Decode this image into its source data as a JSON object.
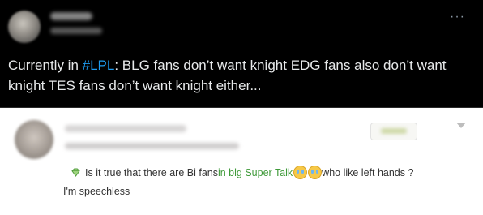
{
  "tweet": {
    "text_before_tag": "Currently in ",
    "hashtag": "#LPL",
    "text_after_tag": ": BLG fans don’t want knight EDG fans also don’t want knight TES fans don’t want knight either...",
    "more_label": "···",
    "colors": {
      "background": "#000000",
      "text": "#e7e9ea",
      "link": "#1d9bf0"
    }
  },
  "comment": {
    "icon": "diamond-icon",
    "text_part1": "Is it true that there are Bi fans ",
    "link_text": "in blg Super Talk",
    "emoji_icons": [
      "crying-face-icon",
      "crying-face-icon"
    ],
    "text_part2": " who like left hands ?",
    "line2": "I'm speechless",
    "colors": {
      "link": "#3f9a3a",
      "text": "#333333"
    }
  }
}
